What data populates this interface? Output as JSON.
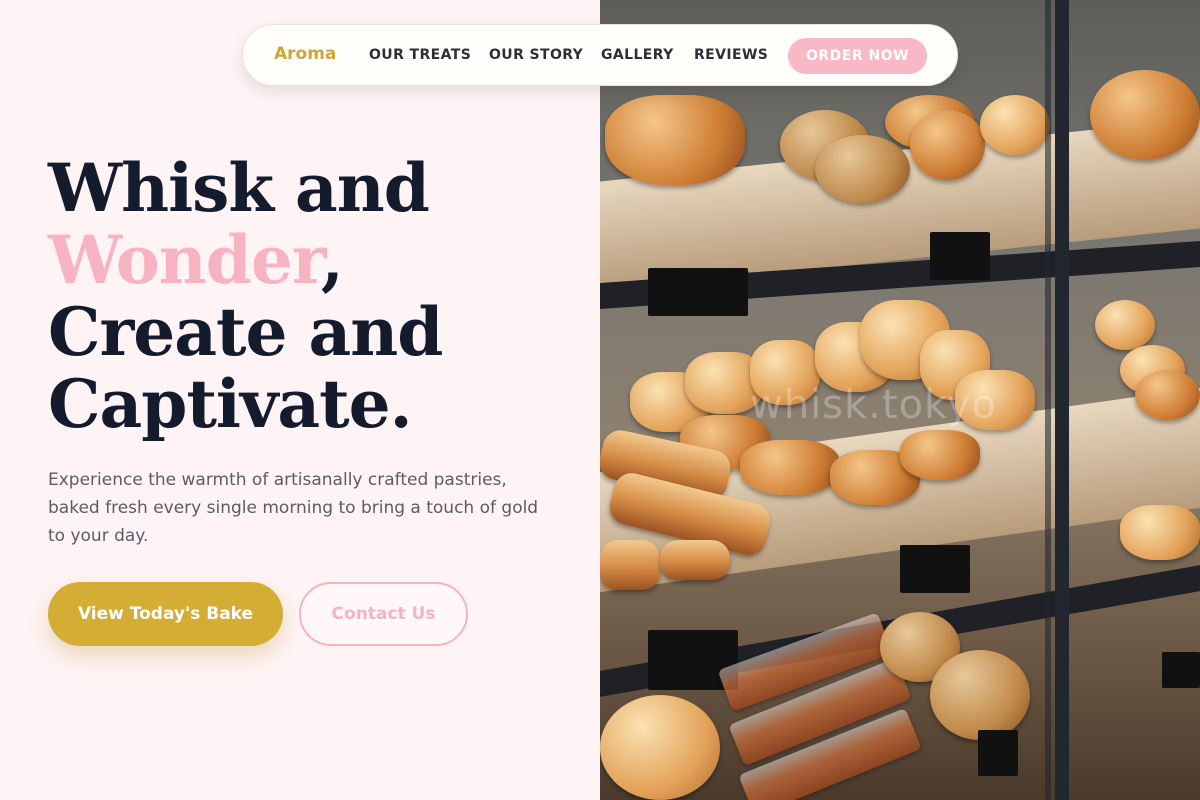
{
  "nav": {
    "brand": "Aroma",
    "items": [
      {
        "label": "OUR TREATS"
      },
      {
        "label": "OUR STORY"
      },
      {
        "label": "GALLERY"
      },
      {
        "label": "REVIEWS"
      }
    ],
    "cta": "ORDER NOW"
  },
  "hero": {
    "line1": "Whisk and",
    "line2_accent": "Wonder",
    "line2_rest": ",",
    "line3": "Create and",
    "line4": "Captivate.",
    "description": "Experience the warmth of artisanally crafted pastries, baked fresh every single morning to bring a touch of gold to your day.",
    "primary_button": "View Today's Bake",
    "secondary_button": "Contact Us"
  },
  "photo": {
    "watermark": "whisk.tokyo"
  },
  "colors": {
    "accent_gold": "#d4ad34",
    "accent_pink": "#f7b3c1",
    "heading_navy": "#141b2d",
    "background": "#fff4f5"
  }
}
